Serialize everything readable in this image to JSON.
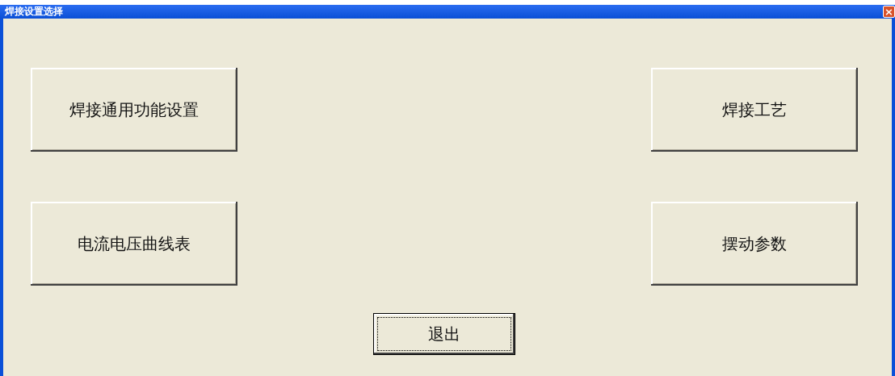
{
  "window": {
    "title": "焊接设置选择",
    "close": "×"
  },
  "buttons": [
    {
      "label": "焊接通用功能设置",
      "focused": false
    },
    {
      "label": "焊接工艺",
      "focused": false
    },
    {
      "label": "电流电压曲线表",
      "focused": false
    },
    {
      "label": "摆动参数",
      "focused": false
    }
  ],
  "exit": {
    "label": "退出",
    "focused": true
  }
}
